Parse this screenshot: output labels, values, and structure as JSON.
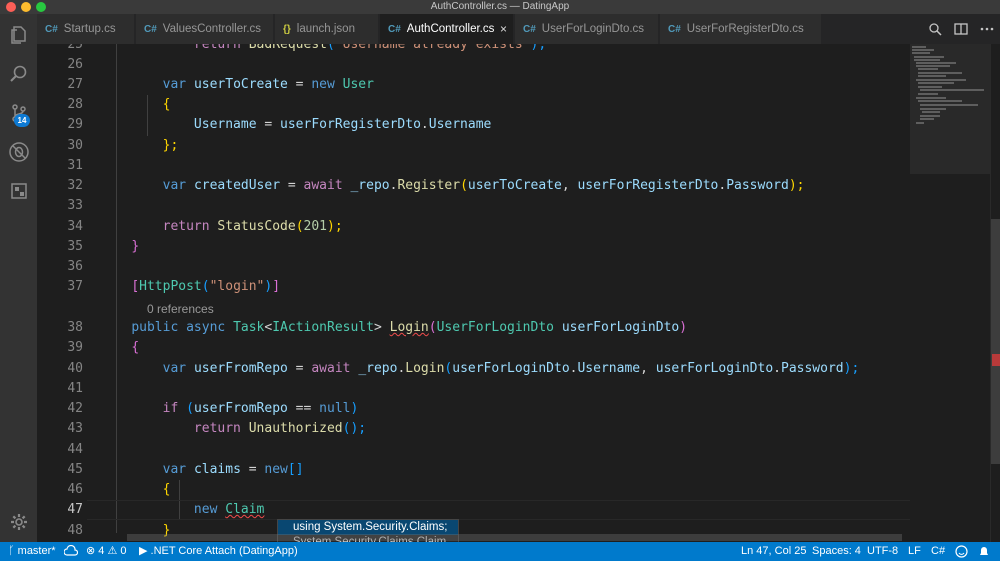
{
  "window": {
    "title": "AuthController.cs — DatingApp"
  },
  "activity_bar": {
    "items": [
      {
        "name": "explorer-icon"
      },
      {
        "name": "search-icon"
      },
      {
        "name": "source-control-icon"
      },
      {
        "name": "debug-icon"
      },
      {
        "name": "extensions-icon"
      }
    ],
    "source_control_badge": "14",
    "settings_icon": "gear-icon"
  },
  "tabs": [
    {
      "label": "Startup.cs",
      "icon_text": "C#",
      "icon_type": "cs",
      "active": false
    },
    {
      "label": "ValuesController.cs",
      "icon_text": "C#",
      "icon_type": "cs",
      "active": false
    },
    {
      "label": "launch.json",
      "icon_text": "{}",
      "icon_type": "json",
      "active": false
    },
    {
      "label": "AuthController.cs",
      "icon_text": "C#",
      "icon_type": "cs",
      "active": true
    },
    {
      "label": "UserForLoginDto.cs",
      "icon_text": "C#",
      "icon_type": "cs",
      "active": false
    },
    {
      "label": "UserForRegisterDto.cs",
      "icon_text": "C#",
      "icon_type": "cs",
      "active": false
    }
  ],
  "tab_close_glyph": "×",
  "tab_actions": [
    "open-changes-icon",
    "split-editor-icon",
    "more-actions-icon"
  ],
  "editor": {
    "current_line": 47,
    "codelens": "0 references",
    "lines": [
      {
        "n": 25,
        "tokens": [
          [
            "            ",
            ""
          ],
          [
            "return",
            "ctl"
          ],
          [
            " ",
            ""
          ],
          [
            "BadRequest",
            "fn"
          ],
          [
            "(",
            "br3"
          ],
          [
            "\"Username already exists\"",
            "str"
          ],
          [
            ");",
            "br3"
          ]
        ]
      },
      {
        "n": 26,
        "tokens": []
      },
      {
        "n": 27,
        "tokens": [
          [
            "        ",
            ""
          ],
          [
            "var",
            "kw"
          ],
          [
            " ",
            ""
          ],
          [
            "userToCreate",
            "var"
          ],
          [
            " = ",
            ""
          ],
          [
            "new",
            "kw"
          ],
          [
            " ",
            ""
          ],
          [
            "User",
            "ty"
          ]
        ]
      },
      {
        "n": 28,
        "tokens": [
          [
            "        ",
            ""
          ],
          [
            "{",
            "br"
          ]
        ]
      },
      {
        "n": 29,
        "tokens": [
          [
            "            ",
            ""
          ],
          [
            "Username",
            "var"
          ],
          [
            " = ",
            ""
          ],
          [
            "userForRegisterDto",
            "var"
          ],
          [
            ".",
            ""
          ],
          [
            "Username",
            "var"
          ]
        ]
      },
      {
        "n": 30,
        "tokens": [
          [
            "        ",
            ""
          ],
          [
            "};",
            "br"
          ]
        ]
      },
      {
        "n": 31,
        "tokens": []
      },
      {
        "n": 32,
        "tokens": [
          [
            "        ",
            ""
          ],
          [
            "var",
            "kw"
          ],
          [
            " ",
            ""
          ],
          [
            "createdUser",
            "var"
          ],
          [
            " = ",
            ""
          ],
          [
            "await",
            "ctl"
          ],
          [
            " ",
            ""
          ],
          [
            "_repo",
            "var"
          ],
          [
            ".",
            ""
          ],
          [
            "Register",
            "fn"
          ],
          [
            "(",
            "br"
          ],
          [
            "userToCreate",
            "var"
          ],
          [
            ", ",
            ""
          ],
          [
            "userForRegisterDto",
            "var"
          ],
          [
            ".",
            ""
          ],
          [
            "Password",
            "var"
          ],
          [
            ");",
            "br"
          ]
        ]
      },
      {
        "n": 33,
        "tokens": []
      },
      {
        "n": 34,
        "tokens": [
          [
            "        ",
            ""
          ],
          [
            "return",
            "ctl"
          ],
          [
            " ",
            ""
          ],
          [
            "StatusCode",
            "fn"
          ],
          [
            "(",
            "br"
          ],
          [
            "201",
            "num"
          ],
          [
            ");",
            "br"
          ]
        ]
      },
      {
        "n": 35,
        "tokens": [
          [
            "    ",
            ""
          ],
          [
            "}",
            "br2"
          ]
        ]
      },
      {
        "n": 36,
        "tokens": []
      },
      {
        "n": 37,
        "tokens": [
          [
            "    ",
            ""
          ],
          [
            "[",
            "br2"
          ],
          [
            "HttpPost",
            "ty"
          ],
          [
            "(",
            "br3"
          ],
          [
            "\"login\"",
            "str"
          ],
          [
            ")",
            "br3"
          ],
          [
            "]",
            "br2"
          ]
        ]
      },
      {
        "n": 38,
        "tokens": [
          [
            "    ",
            ""
          ],
          [
            "public",
            "kw"
          ],
          [
            " ",
            ""
          ],
          [
            "async",
            "kw"
          ],
          [
            " ",
            ""
          ],
          [
            "Task",
            "ty"
          ],
          [
            "<",
            ""
          ],
          [
            "IActionResult",
            "ty"
          ],
          [
            "> ",
            ""
          ],
          [
            "Login",
            "fn squig"
          ],
          [
            "(",
            "br2"
          ],
          [
            "UserForLoginDto",
            "ty"
          ],
          [
            " ",
            ""
          ],
          [
            "userForLoginDto",
            "var"
          ],
          [
            ")",
            "br2"
          ]
        ]
      },
      {
        "n": 39,
        "tokens": [
          [
            "    ",
            ""
          ],
          [
            "{",
            "br2"
          ]
        ]
      },
      {
        "n": 40,
        "tokens": [
          [
            "        ",
            ""
          ],
          [
            "var",
            "kw"
          ],
          [
            " ",
            ""
          ],
          [
            "userFromRepo",
            "var"
          ],
          [
            " = ",
            ""
          ],
          [
            "await",
            "ctl"
          ],
          [
            " ",
            ""
          ],
          [
            "_repo",
            "var"
          ],
          [
            ".",
            ""
          ],
          [
            "Login",
            "fn"
          ],
          [
            "(",
            "br3"
          ],
          [
            "userForLoginDto",
            "var"
          ],
          [
            ".",
            ""
          ],
          [
            "Username",
            "var"
          ],
          [
            ", ",
            ""
          ],
          [
            "userForLoginDto",
            "var"
          ],
          [
            ".",
            ""
          ],
          [
            "Password",
            "var"
          ],
          [
            ");",
            "br3"
          ]
        ]
      },
      {
        "n": 41,
        "tokens": []
      },
      {
        "n": 42,
        "tokens": [
          [
            "        ",
            ""
          ],
          [
            "if",
            "ctl"
          ],
          [
            " ",
            ""
          ],
          [
            "(",
            "br3"
          ],
          [
            "userFromRepo",
            "var"
          ],
          [
            " == ",
            ""
          ],
          [
            "null",
            "kw"
          ],
          [
            ")",
            "br3"
          ]
        ]
      },
      {
        "n": 43,
        "tokens": [
          [
            "            ",
            ""
          ],
          [
            "return",
            "ctl"
          ],
          [
            " ",
            ""
          ],
          [
            "Unauthorized",
            "fn"
          ],
          [
            "();",
            "br3"
          ]
        ]
      },
      {
        "n": 44,
        "tokens": []
      },
      {
        "n": 45,
        "tokens": [
          [
            "        ",
            ""
          ],
          [
            "var",
            "kw"
          ],
          [
            " ",
            ""
          ],
          [
            "claims",
            "var"
          ],
          [
            " = ",
            ""
          ],
          [
            "new",
            "kw"
          ],
          [
            "[]",
            "br3"
          ]
        ]
      },
      {
        "n": 46,
        "tokens": [
          [
            "        ",
            ""
          ],
          [
            "{",
            "br"
          ]
        ]
      },
      {
        "n": 47,
        "tokens": [
          [
            "            ",
            ""
          ],
          [
            "new",
            "kw"
          ],
          [
            " ",
            ""
          ],
          [
            "Claim",
            "ty squig"
          ]
        ]
      },
      {
        "n": 48,
        "tokens": [
          [
            "        ",
            ""
          ],
          [
            "}",
            "br"
          ]
        ]
      }
    ]
  },
  "quick_fix": {
    "items": [
      {
        "label": "using System.Security.Claims;",
        "selected": true
      },
      {
        "label": "System.Security.Claims.Claim",
        "selected": false
      }
    ]
  },
  "status_bar": {
    "branch": "master*",
    "sync_icon": "cloud-sync-icon",
    "errors": "4",
    "warnings": "0",
    "debug_config": ".NET Core Attach (DatingApp)",
    "cursor": "Ln 47, Col 25",
    "spaces": "Spaces: 4",
    "encoding": "UTF-8",
    "eol": "LF",
    "language": "C#",
    "feedback_icon": "smiley-icon",
    "bell_icon": "bell-icon"
  }
}
